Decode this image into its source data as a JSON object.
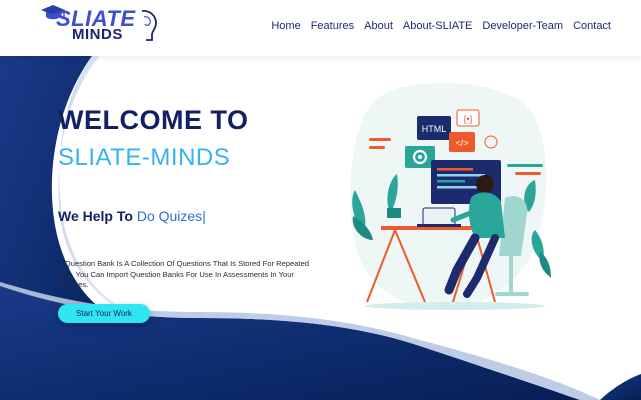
{
  "logo": {
    "line1": "SLIATE",
    "line2": "MINDS"
  },
  "nav": {
    "items": [
      "Home",
      "Features",
      "About",
      "About-SLIATE",
      "Developer-Team",
      "Contact"
    ]
  },
  "hero": {
    "welcome": "WELCOME TO",
    "brand": "SLIATE-MINDS",
    "tagline_prefix": "We Help To ",
    "tagline_typed": "Do Quizes",
    "tagline_cursor": "|",
    "description": "A Question Bank Is A Collection Of Questions That Is Stored For Repeated Use. You Can Import Question Banks For Use In Assessments In Your Courses.",
    "cta_label": "Start Your Work"
  },
  "illustration": {
    "html_card_label": "HTML",
    "code_icon": "</>",
    "brace_icon": "{•}"
  },
  "colors": {
    "navy": "#142064",
    "accent_blue": "#36b2f0",
    "cta_cyan": "#2ee6f0",
    "wave_dark": "#0c2a6b",
    "illustration_teal": "#2aa59a",
    "illustration_orange": "#f05a2a"
  }
}
